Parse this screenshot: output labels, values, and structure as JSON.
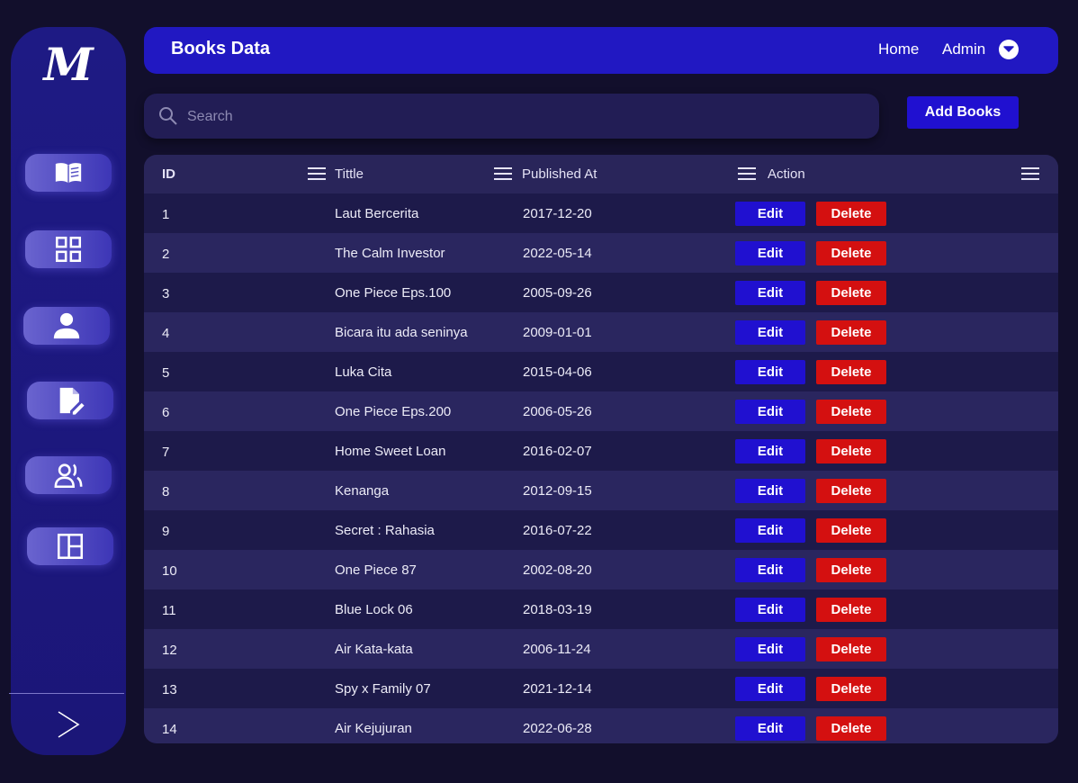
{
  "sidebar": {
    "logo": "M",
    "items": [
      {
        "icon": "book-icon"
      },
      {
        "icon": "dashboard-icon"
      },
      {
        "icon": "user-icon"
      },
      {
        "icon": "edit-document-icon"
      },
      {
        "icon": "users-icon"
      },
      {
        "icon": "layout-icon"
      }
    ],
    "expand_icon": "chevron-right-icon"
  },
  "header": {
    "title": "Books Data",
    "home": "Home",
    "admin": "Admin"
  },
  "search": {
    "placeholder": "Search",
    "value": ""
  },
  "actions": {
    "add_books": "Add Books"
  },
  "table": {
    "columns": [
      "ID",
      "Tittle",
      "Published At",
      "Action"
    ],
    "edit_label": "Edit",
    "delete_label": "Delete",
    "rows": [
      {
        "id": "1",
        "title": "Laut Bercerita",
        "published": "2017-12-20"
      },
      {
        "id": "2",
        "title": "The Calm Investor",
        "published": "2022-05-14"
      },
      {
        "id": "3",
        "title": "One Piece Eps.100",
        "published": "2005-09-26"
      },
      {
        "id": "4",
        "title": "Bicara itu ada seninya",
        "published": "2009-01-01"
      },
      {
        "id": "5",
        "title": "Luka Cita",
        "published": "2015-04-06"
      },
      {
        "id": "6",
        "title": "One Piece Eps.200",
        "published": "2006-05-26"
      },
      {
        "id": "7",
        "title": "Home Sweet Loan",
        "published": "2016-02-07"
      },
      {
        "id": "8",
        "title": "Kenanga",
        "published": "2012-09-15"
      },
      {
        "id": "9",
        "title": "Secret : Rahasia",
        "published": "2016-07-22"
      },
      {
        "id": "10",
        "title": "One Piece 87",
        "published": "2002-08-20"
      },
      {
        "id": "11",
        "title": "Blue Lock 06",
        "published": "2018-03-19"
      },
      {
        "id": "12",
        "title": "Air Kata-kata",
        "published": "2006-11-24"
      },
      {
        "id": "13",
        "title": "Spy x Family 07",
        "published": "2021-12-14"
      },
      {
        "id": "14",
        "title": "Air Kejujuran",
        "published": "2022-06-28"
      }
    ]
  },
  "colors": {
    "background": "#120f2c",
    "sidebar": "#1e1a84",
    "header": "#2118c2",
    "edit": "#2010d0",
    "delete": "#d41010"
  }
}
